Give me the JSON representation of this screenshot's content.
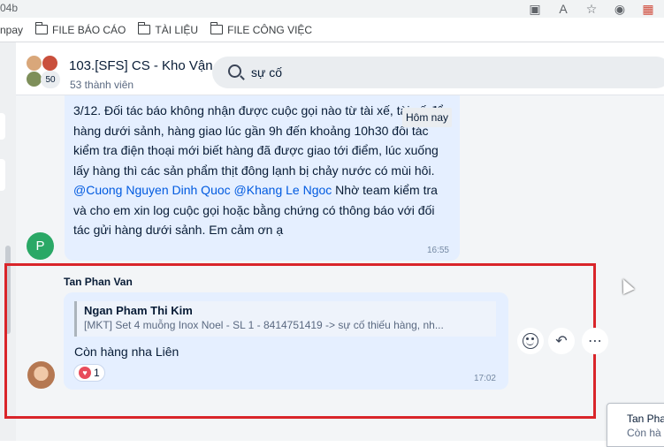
{
  "browser": {
    "url_fragment": "04b",
    "bookmarks": [
      {
        "label": "npay"
      },
      {
        "label": "FILE BÁO CÁO"
      },
      {
        "label": "TÀI LIỆU"
      },
      {
        "label": "FILE CÔNG VIỆC"
      }
    ]
  },
  "header": {
    "title": "103.[SFS] CS - Kho Vận",
    "members": "53 thành viên",
    "avatar_count": "50",
    "search_value": "sự cố"
  },
  "messages": {
    "first": {
      "text_parts": [
        "3/12. Đối tác báo không nhận được cuộc gọi nào từ tài xế, tài xế để hàng dưới sảnh, hàng giao lúc gần 9h đến khoảng 10h30 đối tác kiểm tra điện thoại mới biết hàng đã được giao tới điểm,  lúc xuống lấy hàng thì các sản phẩm thịt đông lạnh bị chảy nước có mùi hôi. ",
        "@Cuong Nguyen Dinh Quoc",
        " ",
        "@Khang Le Ngoc",
        " Nhờ team kiểm tra và cho em xin log cuộc gọi hoặc bằng chứng có thông báo với đối tác gửi hàng dưới sảnh. Em cảm ơn ạ"
      ],
      "time": "16:55",
      "avatar_letter": "P",
      "date_tooltip": "Hôm nay"
    },
    "second": {
      "sender": "Tan Phan Van",
      "quote_name": "Ngan Pham Thi Kim",
      "quote_text": "[MKT] Set 4 muỗng Inox Noel - SL 1 - 8414751419 -> sự cố thiếu hàng, nh...",
      "text": "Còn hàng nha Liên",
      "reaction_count": "1",
      "time": "17:02"
    }
  },
  "popup": {
    "name": "Tan Pha",
    "text": "Còn hà"
  },
  "colors": {
    "bubble": "#e5efff",
    "mention": "#005ae0",
    "highlight": "#d9252a"
  }
}
